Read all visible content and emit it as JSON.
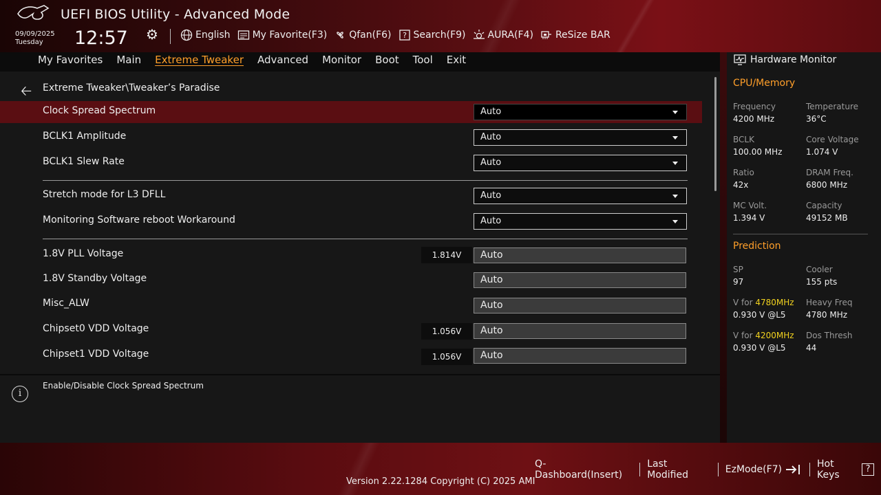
{
  "header": {
    "title": "UEFI BIOS Utility - Advanced Mode",
    "date": "09/09/2025",
    "day": "Tuesday",
    "time": "12:57",
    "toolbar": [
      {
        "label": "English",
        "icon": "globe-icon"
      },
      {
        "label": "My Favorite(F3)",
        "icon": "favorite-icon"
      },
      {
        "label": "Qfan(F6)",
        "icon": "fan-icon"
      },
      {
        "label": "Search(F9)",
        "icon": "search-icon"
      },
      {
        "label": "AURA(F4)",
        "icon": "aura-icon"
      },
      {
        "label": "ReSize BAR",
        "icon": "resize-bar-icon"
      }
    ]
  },
  "tabs": [
    "My Favorites",
    "Main",
    "Extreme Tweaker",
    "Advanced",
    "Monitor",
    "Boot",
    "Tool",
    "Exit"
  ],
  "active_tab": "Extreme Tweaker",
  "breadcrumb": "Extreme Tweaker\\Tweaker’s Paradise",
  "settings": [
    {
      "label": "Clock Spread Spectrum",
      "value": "Auto"
    },
    {
      "label": "BCLK1 Amplitude",
      "value": "Auto"
    },
    {
      "label": "BCLK1 Slew Rate",
      "value": "Auto"
    },
    {
      "label": "Stretch mode for L3 DFLL",
      "value": "Auto"
    },
    {
      "label": "Monitoring Software reboot Workaround",
      "value": "Auto"
    },
    {
      "label": "1.8V PLL Voltage",
      "current": "1.814V",
      "value": "Auto"
    },
    {
      "label": "1.8V Standby Voltage",
      "current": "",
      "value": "Auto"
    },
    {
      "label": "Misc_ALW",
      "current": "",
      "value": "Auto"
    },
    {
      "label": "Chipset0 VDD Voltage",
      "current": "1.056V",
      "value": "Auto"
    },
    {
      "label": "Chipset1 VDD Voltage",
      "current": "1.056V",
      "value": "Auto"
    }
  ],
  "help_text": "Enable/Disable Clock Spread Spectrum",
  "hardware_monitor": {
    "title": "Hardware Monitor",
    "cpu_section": "CPU/Memory",
    "cpu": [
      {
        "label": "Frequency",
        "value": "4200 MHz"
      },
      {
        "label": "Temperature",
        "value": "36°C"
      },
      {
        "label": "BCLK",
        "value": "100.00 MHz"
      },
      {
        "label": "Core Voltage",
        "value": "1.074 V"
      },
      {
        "label": "Ratio",
        "value": "42x"
      },
      {
        "label": "DRAM Freq.",
        "value": "6800 MHz"
      },
      {
        "label": "MC Volt.",
        "value": "1.394 V"
      },
      {
        "label": "Capacity",
        "value": "49152 MB"
      }
    ],
    "prediction_section": "Prediction",
    "prediction": {
      "sp_label": "SP",
      "sp_value": "97",
      "cooler_label": "Cooler",
      "cooler_value": "155 pts",
      "v1_label_prefix": "V for ",
      "v1_freq": "4780MHz",
      "v1_value": "0.930 V @L5",
      "heavy_label": "Heavy Freq",
      "heavy_value": "4780 MHz",
      "v2_label_prefix": "V for ",
      "v2_freq": "4200MHz",
      "v2_value": "0.930 V @L5",
      "dos_label": "Dos Thresh",
      "dos_value": "44"
    }
  },
  "footer": {
    "items": [
      "Q-Dashboard(Insert)",
      "Last Modified",
      "EzMode(F7)",
      "Hot Keys"
    ],
    "hotkeys_glyph": "?",
    "version": "Version 2.22.1284 Copyright (C) 2025 AMI"
  },
  "colors": {
    "accent": "#ff9f2a",
    "highlight_row": "#5a0e12",
    "prediction_value": "#f2d21f"
  }
}
